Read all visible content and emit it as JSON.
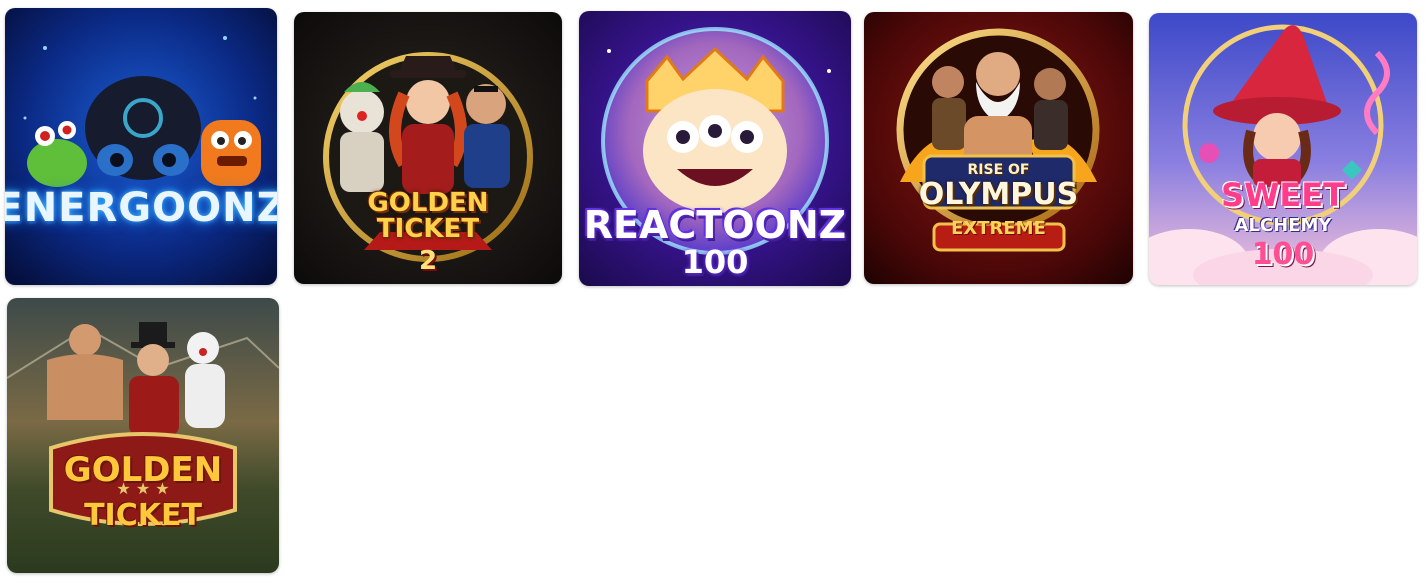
{
  "games": [
    {
      "id": "energoonz",
      "logo": "ENERGOONZ"
    },
    {
      "id": "golden-ticket-2",
      "logo_line1": "GOLDEN",
      "logo_line2": "TICKET",
      "logo_num": "2"
    },
    {
      "id": "reactoonz-100",
      "logo": "REACTOONZ",
      "logo_sub": "100"
    },
    {
      "id": "rise-of-olympus-extreme",
      "logo_pre": "RISE OF",
      "logo": "OLYMPUS",
      "logo_sub": "EXTREME"
    },
    {
      "id": "sweet-alchemy-100",
      "logo": "SWEET",
      "logo_mid": "ALCHEMY",
      "logo_sub": "100"
    },
    {
      "id": "golden-ticket",
      "logo": "GOLDEN",
      "logo_sub": "TICKET"
    }
  ]
}
